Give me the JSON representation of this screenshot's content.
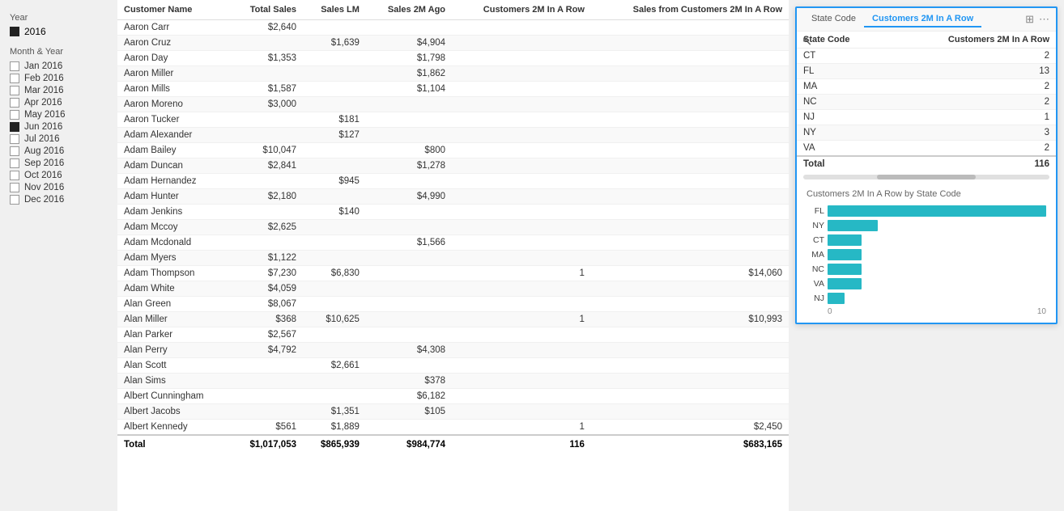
{
  "sidebar": {
    "year_label": "Year",
    "years": [
      {
        "label": "2016",
        "checked": true
      }
    ],
    "month_label": "Month & Year",
    "months": [
      {
        "label": "Jan 2016",
        "checked": false
      },
      {
        "label": "Feb 2016",
        "checked": false
      },
      {
        "label": "Mar 2016",
        "checked": false
      },
      {
        "label": "Apr 2016",
        "checked": false
      },
      {
        "label": "May 2016",
        "checked": false
      },
      {
        "label": "Jun 2016",
        "checked": true
      },
      {
        "label": "Jul 2016",
        "checked": false
      },
      {
        "label": "Aug 2016",
        "checked": false
      },
      {
        "label": "Sep 2016",
        "checked": false
      },
      {
        "label": "Oct 2016",
        "checked": false
      },
      {
        "label": "Nov 2016",
        "checked": false
      },
      {
        "label": "Dec 2016",
        "checked": false
      }
    ]
  },
  "table": {
    "columns": [
      "Customer Name",
      "Total Sales",
      "Sales LM",
      "Sales 2M Ago",
      "Customers 2M In A Row",
      "Sales from Customers 2M In A Row"
    ],
    "rows": [
      {
        "name": "Aaron Carr",
        "total_sales": "$2,640",
        "sales_lm": "",
        "sales_2m": "",
        "cust_2m": "",
        "sales_from": ""
      },
      {
        "name": "Aaron Cruz",
        "total_sales": "",
        "sales_lm": "$1,639",
        "sales_2m": "$4,904",
        "cust_2m": "",
        "sales_from": ""
      },
      {
        "name": "Aaron Day",
        "total_sales": "$1,353",
        "sales_lm": "",
        "sales_2m": "$1,798",
        "cust_2m": "",
        "sales_from": ""
      },
      {
        "name": "Aaron Miller",
        "total_sales": "",
        "sales_lm": "",
        "sales_2m": "$1,862",
        "cust_2m": "",
        "sales_from": ""
      },
      {
        "name": "Aaron Mills",
        "total_sales": "$1,587",
        "sales_lm": "",
        "sales_2m": "$1,104",
        "cust_2m": "",
        "sales_from": ""
      },
      {
        "name": "Aaron Moreno",
        "total_sales": "$3,000",
        "sales_lm": "",
        "sales_2m": "",
        "cust_2m": "",
        "sales_from": ""
      },
      {
        "name": "Aaron Tucker",
        "total_sales": "",
        "sales_lm": "$181",
        "sales_2m": "",
        "cust_2m": "",
        "sales_from": ""
      },
      {
        "name": "Adam Alexander",
        "total_sales": "",
        "sales_lm": "$127",
        "sales_2m": "",
        "cust_2m": "",
        "sales_from": ""
      },
      {
        "name": "Adam Bailey",
        "total_sales": "$10,047",
        "sales_lm": "",
        "sales_2m": "$800",
        "cust_2m": "",
        "sales_from": ""
      },
      {
        "name": "Adam Duncan",
        "total_sales": "$2,841",
        "sales_lm": "",
        "sales_2m": "$1,278",
        "cust_2m": "",
        "sales_from": ""
      },
      {
        "name": "Adam Hernandez",
        "total_sales": "",
        "sales_lm": "$945",
        "sales_2m": "",
        "cust_2m": "",
        "sales_from": ""
      },
      {
        "name": "Adam Hunter",
        "total_sales": "$2,180",
        "sales_lm": "",
        "sales_2m": "$4,990",
        "cust_2m": "",
        "sales_from": ""
      },
      {
        "name": "Adam Jenkins",
        "total_sales": "",
        "sales_lm": "$140",
        "sales_2m": "",
        "cust_2m": "",
        "sales_from": ""
      },
      {
        "name": "Adam Mccoy",
        "total_sales": "$2,625",
        "sales_lm": "",
        "sales_2m": "",
        "cust_2m": "",
        "sales_from": ""
      },
      {
        "name": "Adam Mcdonald",
        "total_sales": "",
        "sales_lm": "",
        "sales_2m": "$1,566",
        "cust_2m": "",
        "sales_from": ""
      },
      {
        "name": "Adam Myers",
        "total_sales": "$1,122",
        "sales_lm": "",
        "sales_2m": "",
        "cust_2m": "",
        "sales_from": ""
      },
      {
        "name": "Adam Thompson",
        "total_sales": "$7,230",
        "sales_lm": "$6,830",
        "sales_2m": "",
        "cust_2m": "1",
        "sales_from": "$14,060"
      },
      {
        "name": "Adam White",
        "total_sales": "$4,059",
        "sales_lm": "",
        "sales_2m": "",
        "cust_2m": "",
        "sales_from": ""
      },
      {
        "name": "Alan Green",
        "total_sales": "$8,067",
        "sales_lm": "",
        "sales_2m": "",
        "cust_2m": "",
        "sales_from": ""
      },
      {
        "name": "Alan Miller",
        "total_sales": "$368",
        "sales_lm": "$10,625",
        "sales_2m": "",
        "cust_2m": "1",
        "sales_from": "$10,993"
      },
      {
        "name": "Alan Parker",
        "total_sales": "$2,567",
        "sales_lm": "",
        "sales_2m": "",
        "cust_2m": "",
        "sales_from": ""
      },
      {
        "name": "Alan Perry",
        "total_sales": "$4,792",
        "sales_lm": "",
        "sales_2m": "$4,308",
        "cust_2m": "",
        "sales_from": ""
      },
      {
        "name": "Alan Scott",
        "total_sales": "",
        "sales_lm": "$2,661",
        "sales_2m": "",
        "cust_2m": "",
        "sales_from": ""
      },
      {
        "name": "Alan Sims",
        "total_sales": "",
        "sales_lm": "",
        "sales_2m": "$378",
        "cust_2m": "",
        "sales_from": ""
      },
      {
        "name": "Albert Cunningham",
        "total_sales": "",
        "sales_lm": "",
        "sales_2m": "$6,182",
        "cust_2m": "",
        "sales_from": ""
      },
      {
        "name": "Albert Jacobs",
        "total_sales": "",
        "sales_lm": "$1,351",
        "sales_2m": "$105",
        "cust_2m": "",
        "sales_from": ""
      },
      {
        "name": "Albert Kennedy",
        "total_sales": "$561",
        "sales_lm": "$1,889",
        "sales_2m": "",
        "cust_2m": "1",
        "sales_from": "$2,450"
      }
    ],
    "totals": {
      "label": "Total",
      "total_sales": "$1,017,053",
      "sales_lm": "$865,939",
      "sales_2m": "$984,774",
      "cust_2m": "116",
      "sales_from": "$683,165"
    }
  },
  "tooltip": {
    "tabs": [
      {
        "label": "State Code",
        "active": false
      },
      {
        "label": "Customers 2M In A Row",
        "active": true
      }
    ],
    "icons": [
      "⊞",
      "⋯"
    ],
    "table": {
      "columns": [
        "State Code",
        "Customers 2M In A Row"
      ],
      "rows": [
        {
          "state": "CT",
          "count": "2"
        },
        {
          "state": "FL",
          "count": "13"
        },
        {
          "state": "MA",
          "count": "2"
        },
        {
          "state": "NC",
          "count": "2"
        },
        {
          "state": "NJ",
          "count": "1"
        },
        {
          "state": "NY",
          "count": "3"
        },
        {
          "state": "VA",
          "count": "2"
        }
      ],
      "total_label": "Total",
      "total_count": "116"
    },
    "chart": {
      "title": "Customers 2M In A Row by State Code",
      "max_value": 13,
      "axis_min": "0",
      "axis_max": "10",
      "bars": [
        {
          "label": "FL",
          "value": 13
        },
        {
          "label": "NY",
          "value": 3
        },
        {
          "label": "CT",
          "value": 2
        },
        {
          "label": "MA",
          "value": 2
        },
        {
          "label": "NC",
          "value": 2
        },
        {
          "label": "VA",
          "value": 2
        },
        {
          "label": "NJ",
          "value": 1
        }
      ]
    }
  }
}
